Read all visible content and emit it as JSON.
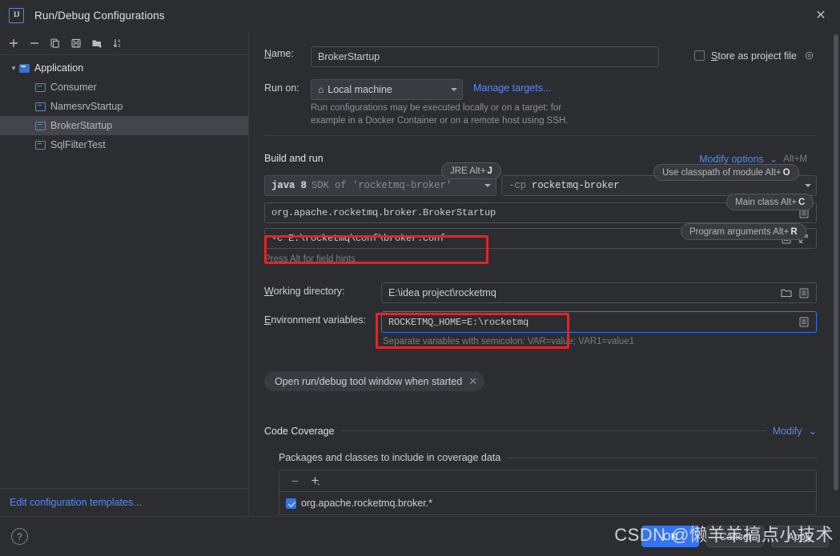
{
  "window": {
    "title": "Run/Debug Configurations",
    "logo_text": "IJ",
    "close_icon": "close-icon"
  },
  "left_panel": {
    "toolbar": [
      {
        "name": "add-configuration-button",
        "icon": "plus-icon"
      },
      {
        "name": "remove-configuration-button",
        "icon": "minus-icon"
      },
      {
        "name": "copy-configuration-button",
        "icon": "copy-icon"
      },
      {
        "name": "save-configuration-button",
        "icon": "save-icon"
      },
      {
        "name": "new-folder-button",
        "icon": "folder-add-icon"
      },
      {
        "name": "sort-configurations-button",
        "icon": "sort-alpha-icon"
      }
    ],
    "tree": {
      "root": {
        "label": "Application",
        "expanded": true
      },
      "children": [
        {
          "label": "Consumer",
          "selected": false
        },
        {
          "label": "NamesrvStartup",
          "selected": false
        },
        {
          "label": "BrokerStartup",
          "selected": true
        },
        {
          "label": "SqlFilterTest",
          "selected": false
        }
      ]
    },
    "edit_templates_link": "Edit configuration templates..."
  },
  "form": {
    "name_label": "Name:",
    "name_value": "BrokerStartup",
    "store_as_project_file_label": "Store as project file",
    "store_as_project_file_checked": false,
    "store_gear_icon": "gear-icon",
    "run_on_label": "Run on:",
    "run_on_value": "Local machine",
    "run_on_icon": "home-icon",
    "manage_targets_link": "Manage targets...",
    "run_on_help_line1": "Run configurations may be executed locally or on a target: for",
    "run_on_help_line2": "example in a Docker Container or on a remote host using SSH.",
    "build_and_run_label": "Build and run",
    "modify_options_link": "Modify options",
    "modify_options_shortcut": "Alt+M",
    "jre_value": "java 8",
    "jre_value_dim": "SDK of 'rocketmq-broker'",
    "classpath_prefix": "-cp",
    "classpath_value": "rocketmq-broker",
    "main_class_value": "org.apache.rocketmq.broker.BrokerStartup",
    "program_args_value": "-c E:\\rocketmq\\conf\\broker.conf",
    "press_alt_hint": "Press Alt for field hints",
    "working_dir_label": "Working directory:",
    "working_dir_value": "E:\\idea project\\rocketmq",
    "env_vars_label": "Environment variables:",
    "env_vars_value": "ROCKETMQ_HOME=E:\\rocketmq",
    "env_vars_help": "Separate variables with semicolon: VAR=value; VAR1=value1",
    "open_tool_window_chip": "Open run/debug tool window when started",
    "chip_close_icon": "close-icon"
  },
  "tooltips": [
    {
      "name": "jre-hint",
      "text": "JRE Alt+",
      "key": "J"
    },
    {
      "name": "use-classpath-of-module-hint",
      "text": "Use classpath of module Alt+",
      "key": "O"
    },
    {
      "name": "main-class-hint",
      "text": "Main class Alt+",
      "key": "C"
    },
    {
      "name": "program-arguments-hint",
      "text": "Program arguments Alt+",
      "key": "R"
    }
  ],
  "code_coverage": {
    "section_label": "Code Coverage",
    "modify_link": "Modify",
    "packages_label": "Packages and classes to include in coverage data",
    "remove_icon": "minus-icon",
    "add_icon": "plus-icon",
    "items": [
      {
        "label": "org.apache.rocketmq.broker.*",
        "checked": true
      }
    ]
  },
  "bottom_bar": {
    "help_icon": "question-mark-icon",
    "ok_label": "OK",
    "cancel_label": "Cancel",
    "apply_label": "Apply"
  },
  "watermark": {
    "text": "CSDN @懒羊羊搞点小技术"
  },
  "colors": {
    "accent_blue": "#3574f0",
    "link_blue": "#548af7",
    "annotation_red": "#ee2020",
    "panel_bg": "#2b2d30",
    "selected_row": "#43454a"
  }
}
